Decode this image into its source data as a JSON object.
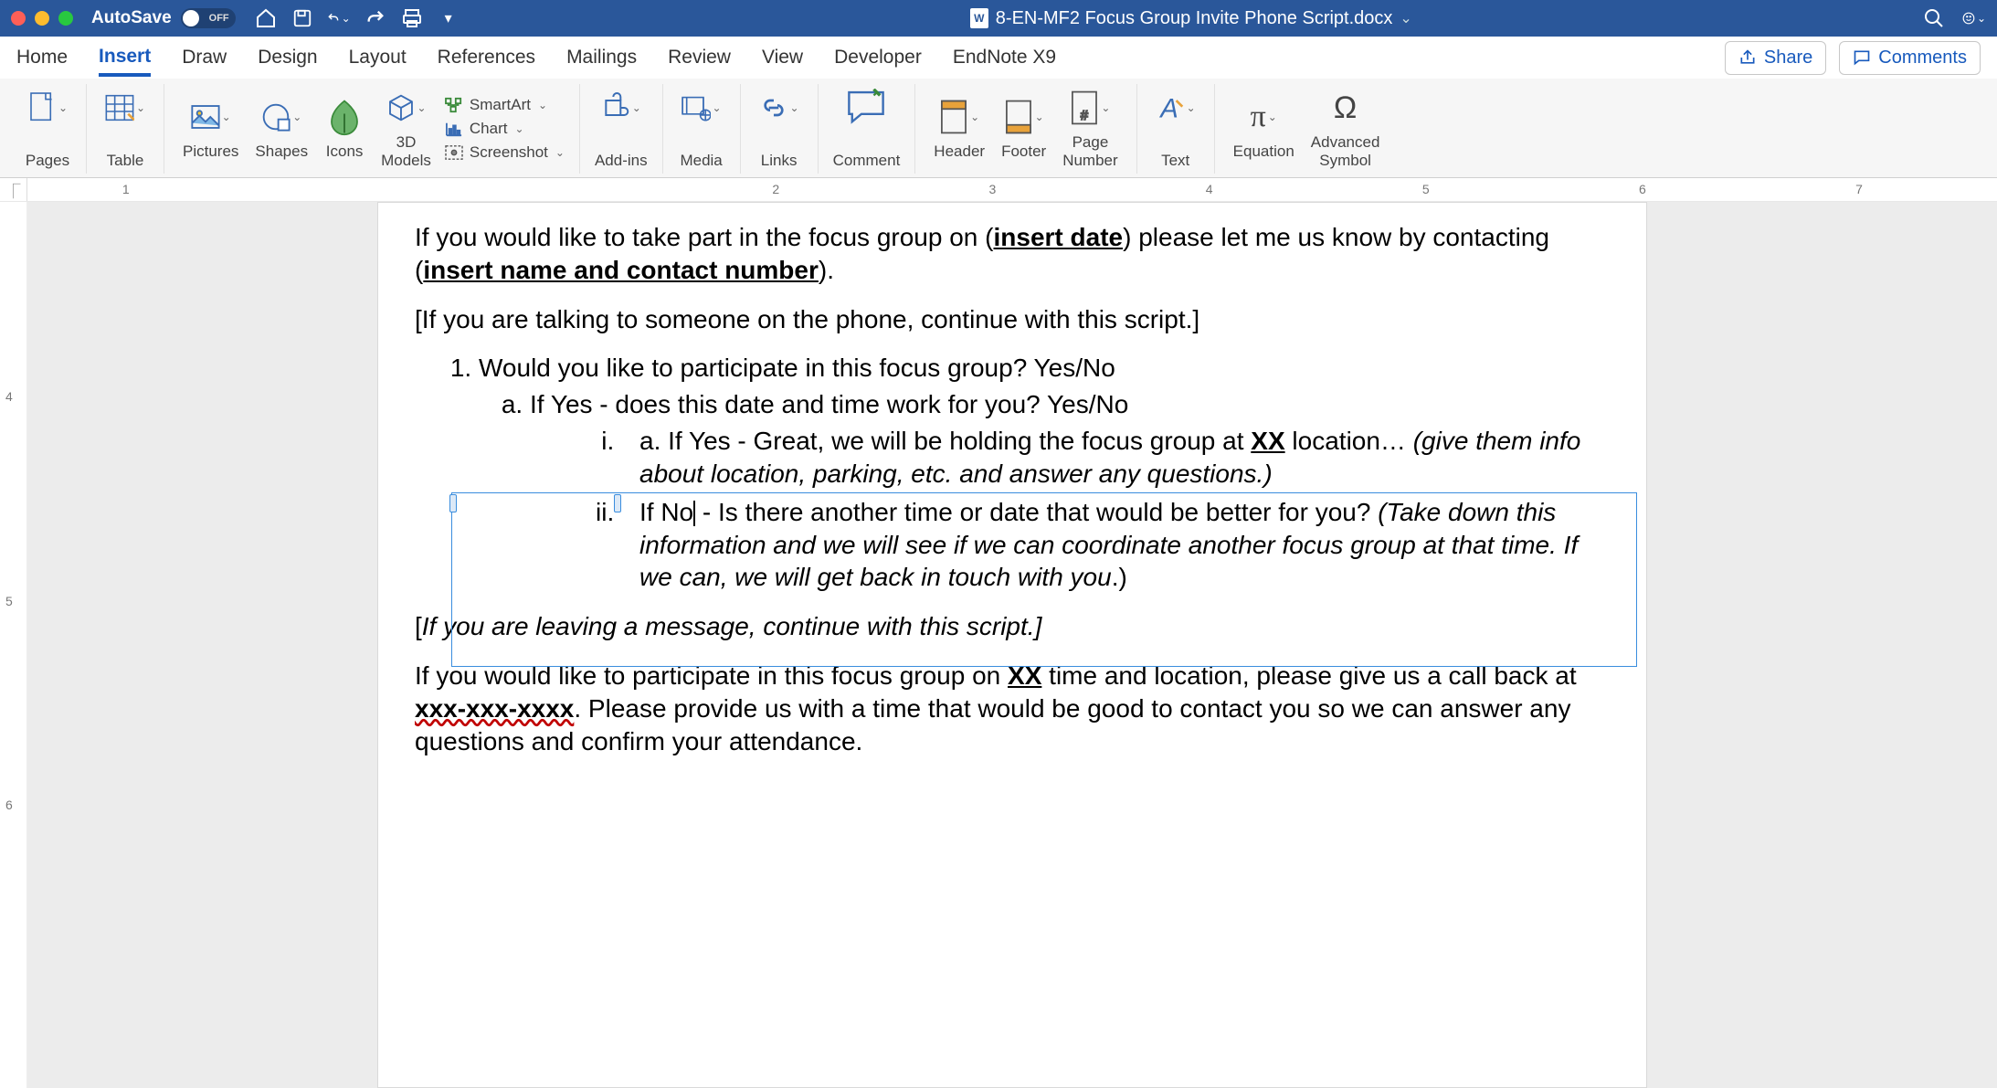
{
  "titlebar": {
    "autosave_label": "AutoSave",
    "autosave_state": "OFF",
    "filename": "8-EN-MF2 Focus Group Invite Phone Script.docx"
  },
  "tabs": {
    "items": [
      "Home",
      "Insert",
      "Draw",
      "Design",
      "Layout",
      "References",
      "Mailings",
      "Review",
      "View",
      "Developer",
      "EndNote X9"
    ],
    "active_index": 1,
    "share": "Share",
    "comments": "Comments"
  },
  "ribbon": {
    "pages": "Pages",
    "table": "Table",
    "pictures": "Pictures",
    "shapes": "Shapes",
    "icons": "Icons",
    "models": "3D\nModels",
    "smartart": "SmartArt",
    "chart": "Chart",
    "screenshot": "Screenshot",
    "addins": "Add-ins",
    "media": "Media",
    "links": "Links",
    "comment": "Comment",
    "header": "Header",
    "footer": "Footer",
    "pagenum": "Page\nNumber",
    "text": "Text",
    "equation": "Equation",
    "symbol": "Advanced\nSymbol"
  },
  "doc": {
    "p1_a": "If you would like to take part in the focus group on (",
    "p1_u1": "insert date",
    "p1_b": ") please let me us know by contacting (",
    "p1_u2": "insert name and contact number",
    "p1_c": ").",
    "p2": "[If you are talking to someone on the phone, continue with this script.]",
    "q1": "Would you like to participate in this focus group? Yes/No",
    "a1": "If Yes - does this date and time work for you? Yes/No",
    "i1_a": "a. If Yes - Great, we will be holding the focus group at ",
    "i1_xx": "XX",
    "i1_b": " location… ",
    "i1_it": "(give them info about location, parking, etc. and answer any questions.)",
    "i2_a": "If No",
    "i2_b": " - Is there another time or date that would be better for you?  ",
    "i2_it": "(Take down this information and we will see if we can coordinate another focus group at that time. If we can, we will get back in touch with you",
    "i2_c": ".)",
    "p3_a": "[",
    "p3_it": "If you are leaving a message, continue with this script.]",
    "p4_a": "If you would like to participate in this focus group on ",
    "p4_xx": "XX",
    "p4_b": " time and location, please give us a call back at ",
    "p4_ph": "xxx-xxx-xxxx",
    "p4_c": ". Please provide us with a time that would be good to contact you so we can answer any questions and confirm your attendance."
  },
  "ruler_h": [
    "1",
    "2",
    "3",
    "4",
    "5",
    "6",
    "7"
  ],
  "ruler_v": [
    "4",
    "5",
    "6"
  ]
}
